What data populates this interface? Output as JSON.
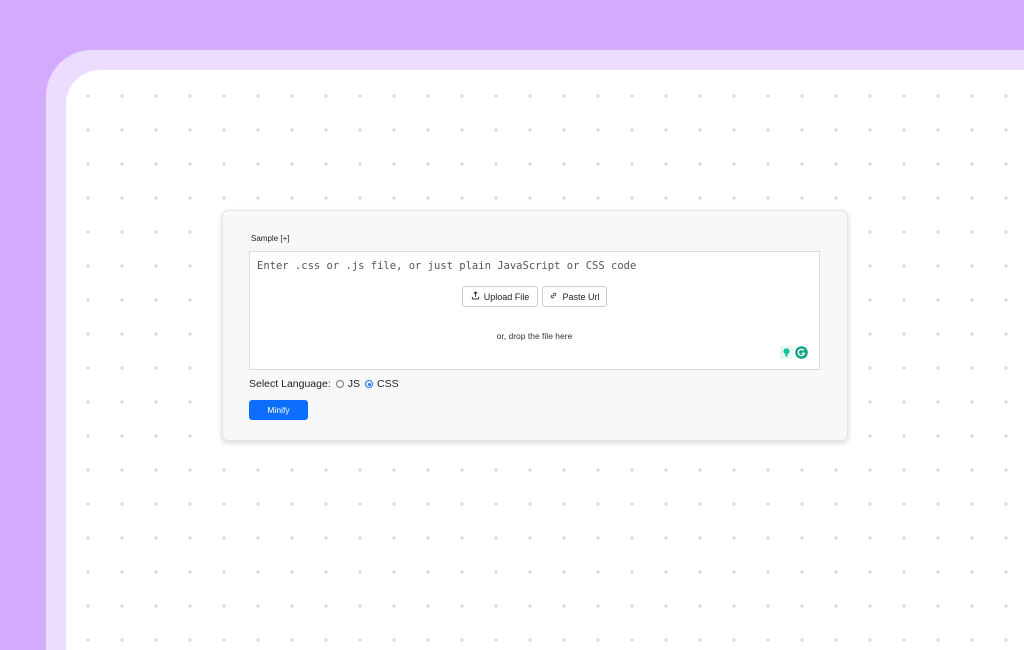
{
  "sample_link": "Sample [+]",
  "editor": {
    "placeholder": "Enter .css or .js file, or just plain JavaScript or CSS code",
    "upload_label": "Upload File",
    "paste_label": "Paste Url",
    "drop_hint": "or, drop the file here"
  },
  "language": {
    "label": "Select Language:",
    "options": [
      {
        "label": "JS",
        "selected": false
      },
      {
        "label": "CSS",
        "selected": true
      }
    ]
  },
  "minify_label": "Minify",
  "colors": {
    "background": "#d4aaff",
    "accent": "#0d6efd"
  },
  "icons": [
    "upload-icon",
    "link-icon",
    "grammarly-bulb-icon",
    "grammarly-g-icon"
  ]
}
